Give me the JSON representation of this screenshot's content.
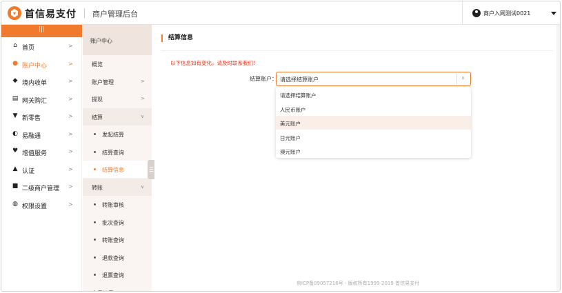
{
  "header": {
    "brand": "首信易支付",
    "subtitle": "商户管理后台",
    "user": "商户入网测试0021"
  },
  "sidebar": {
    "toggle": "|||",
    "items": [
      {
        "label": "首页",
        "icon": "home-icon",
        "glyph": "⌂"
      },
      {
        "label": "账户中心",
        "icon": "user-icon",
        "glyph": "●",
        "active": true
      },
      {
        "label": "境内收单",
        "icon": "layers-icon",
        "glyph": "◆"
      },
      {
        "label": "网关购汇",
        "icon": "bank-icon",
        "glyph": "▤"
      },
      {
        "label": "新零售",
        "icon": "cart-icon",
        "glyph": "▼"
      },
      {
        "label": "易融通",
        "icon": "swap-icon",
        "glyph": "◐"
      },
      {
        "label": "增值服务",
        "icon": "heart-icon",
        "glyph": "♥"
      },
      {
        "label": "认证",
        "icon": "person-icon",
        "glyph": "▲"
      },
      {
        "label": "二级商户管理",
        "icon": "id-card-icon",
        "glyph": "■"
      },
      {
        "label": "权限设置",
        "icon": "lock-icon",
        "glyph": "◍"
      }
    ],
    "arrow": ">"
  },
  "subnav": {
    "title": "账户中心",
    "items": [
      {
        "label": "概览",
        "type": "plain"
      },
      {
        "label": "账户管理",
        "type": "plain",
        "arrow": ">"
      },
      {
        "label": "提现",
        "type": "plain",
        "arrow": ">"
      },
      {
        "label": "结算",
        "type": "group",
        "arrow": "∨"
      },
      {
        "label": "发起结算",
        "type": "child"
      },
      {
        "label": "结算查询",
        "type": "child"
      },
      {
        "label": "结算信息",
        "type": "child",
        "active": true
      },
      {
        "label": "转账",
        "type": "group",
        "arrow": "∨"
      },
      {
        "label": "转账审核",
        "type": "child"
      },
      {
        "label": "批次查询",
        "type": "child"
      },
      {
        "label": "转账查询",
        "type": "child"
      },
      {
        "label": "退款查询",
        "type": "child"
      },
      {
        "label": "退票查询",
        "type": "child"
      },
      {
        "label": "交易记录",
        "type": "plain",
        "arrow": ">"
      }
    ]
  },
  "main": {
    "section_title": "结算信息",
    "notice": "以下信息如有变化，请及时联系我们!",
    "field_label": "结算账户：",
    "select_value": "请选择结算账户",
    "options": [
      "请选择结算账户",
      "人民币账户",
      "美元账户",
      "日元账户",
      "澳元账户"
    ],
    "hover_index": 2,
    "footer": "京ICP备09057216号 - 版权所有1999-2019 首信易支付"
  },
  "colors": {
    "accent": "#f07b2e",
    "notice": "#e5341f"
  }
}
